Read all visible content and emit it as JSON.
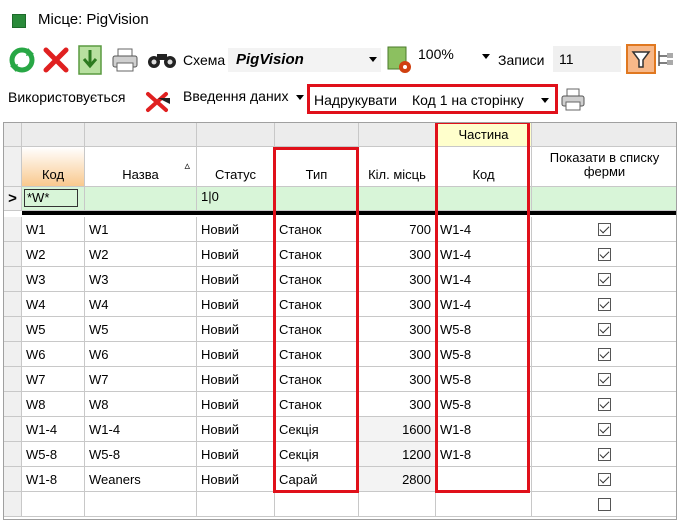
{
  "window": {
    "title": "Місце: PigVision"
  },
  "toolbar": {
    "schema_label": "Схема",
    "schema_value": "PigVision",
    "zoom": "100%",
    "records_label": "Записи",
    "records_value": "11"
  },
  "toolbar2": {
    "used_label": "Використовується",
    "data_entry_label": "Введення даних",
    "print_label": "Надрукувати",
    "print_value": "Код 1 на сторінку"
  },
  "grid": {
    "group_header": "Частина",
    "columns": [
      "Код",
      "Назва",
      "Статус",
      "Тип",
      "Кіл. місць",
      "Код",
      "Показати в списку ферми"
    ],
    "filter_row": {
      "row_marker": ">",
      "code": "*W*",
      "status": "1|0"
    },
    "rows": [
      {
        "code": "W1",
        "name": "W1",
        "status": "Новий",
        "type": "Станок",
        "places": "700",
        "part_code": "W1-4",
        "show": true
      },
      {
        "code": "W2",
        "name": "W2",
        "status": "Новий",
        "type": "Станок",
        "places": "300",
        "part_code": "W1-4",
        "show": true
      },
      {
        "code": "W3",
        "name": "W3",
        "status": "Новий",
        "type": "Станок",
        "places": "300",
        "part_code": "W1-4",
        "show": true
      },
      {
        "code": "W4",
        "name": "W4",
        "status": "Новий",
        "type": "Станок",
        "places": "300",
        "part_code": "W1-4",
        "show": true
      },
      {
        "code": "W5",
        "name": "W5",
        "status": "Новий",
        "type": "Станок",
        "places": "300",
        "part_code": "W5-8",
        "show": true
      },
      {
        "code": "W6",
        "name": "W6",
        "status": "Новий",
        "type": "Станок",
        "places": "300",
        "part_code": "W5-8",
        "show": true
      },
      {
        "code": "W7",
        "name": "W7",
        "status": "Новий",
        "type": "Станок",
        "places": "300",
        "part_code": "W5-8",
        "show": true
      },
      {
        "code": "W8",
        "name": "W8",
        "status": "Новий",
        "type": "Станок",
        "places": "300",
        "part_code": "W5-8",
        "show": true
      },
      {
        "code": "W1-4",
        "name": "W1-4",
        "status": "Новий",
        "type": "Секція",
        "places": "1600",
        "part_code": "W1-8",
        "show": true
      },
      {
        "code": "W5-8",
        "name": "W5-8",
        "status": "Новий",
        "type": "Секція",
        "places": "1200",
        "part_code": "W1-8",
        "show": true
      },
      {
        "code": "W1-8",
        "name": "Weaners",
        "status": "Новий",
        "type": "Сарай",
        "places": "2800",
        "part_code": "",
        "show": true
      },
      {
        "code": "",
        "name": "",
        "status": "",
        "type": "",
        "places": "",
        "part_code": "",
        "show": false
      }
    ]
  },
  "colors": {
    "accent_red": "#e0101a",
    "filter_row": "#d8f5d8",
    "code_header": "#f9c98e",
    "group_header": "#ffffcc",
    "filter_active": "#f7b889"
  },
  "icons": [
    "refresh-icon",
    "delete-icon",
    "export-icon",
    "printer-icon",
    "binoculars-icon",
    "report-settings-icon",
    "filter-icon",
    "tree-icon",
    "printer-small-icon"
  ]
}
